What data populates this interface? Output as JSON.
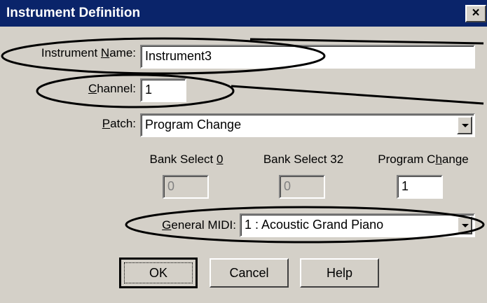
{
  "window": {
    "title": "Instrument Definition",
    "close_glyph": "×"
  },
  "fields": {
    "instrument_name": {
      "label": "Instrument Name:",
      "value": "Instrument3"
    },
    "channel": {
      "label": "Channel:",
      "value": "1"
    },
    "patch": {
      "label": "Patch:",
      "value": "Program Change"
    },
    "bank_select_0": {
      "label": "Bank Select 0",
      "value": "0"
    },
    "bank_select_32": {
      "label": "Bank Select 32",
      "value": "0"
    },
    "program_change": {
      "label": "Program Change",
      "value": "1"
    },
    "general_midi": {
      "label": "General MIDI:",
      "value": "1 : Acoustic Grand Piano"
    }
  },
  "buttons": {
    "ok": "OK",
    "cancel": "Cancel",
    "help": "Help"
  },
  "colors": {
    "titlebar": "#0a246a",
    "dialog_bg": "#d4d0c8",
    "annotation_ink": "#000000"
  },
  "icons": {
    "close": "close-icon",
    "dropdown": "chevron-down-icon"
  }
}
